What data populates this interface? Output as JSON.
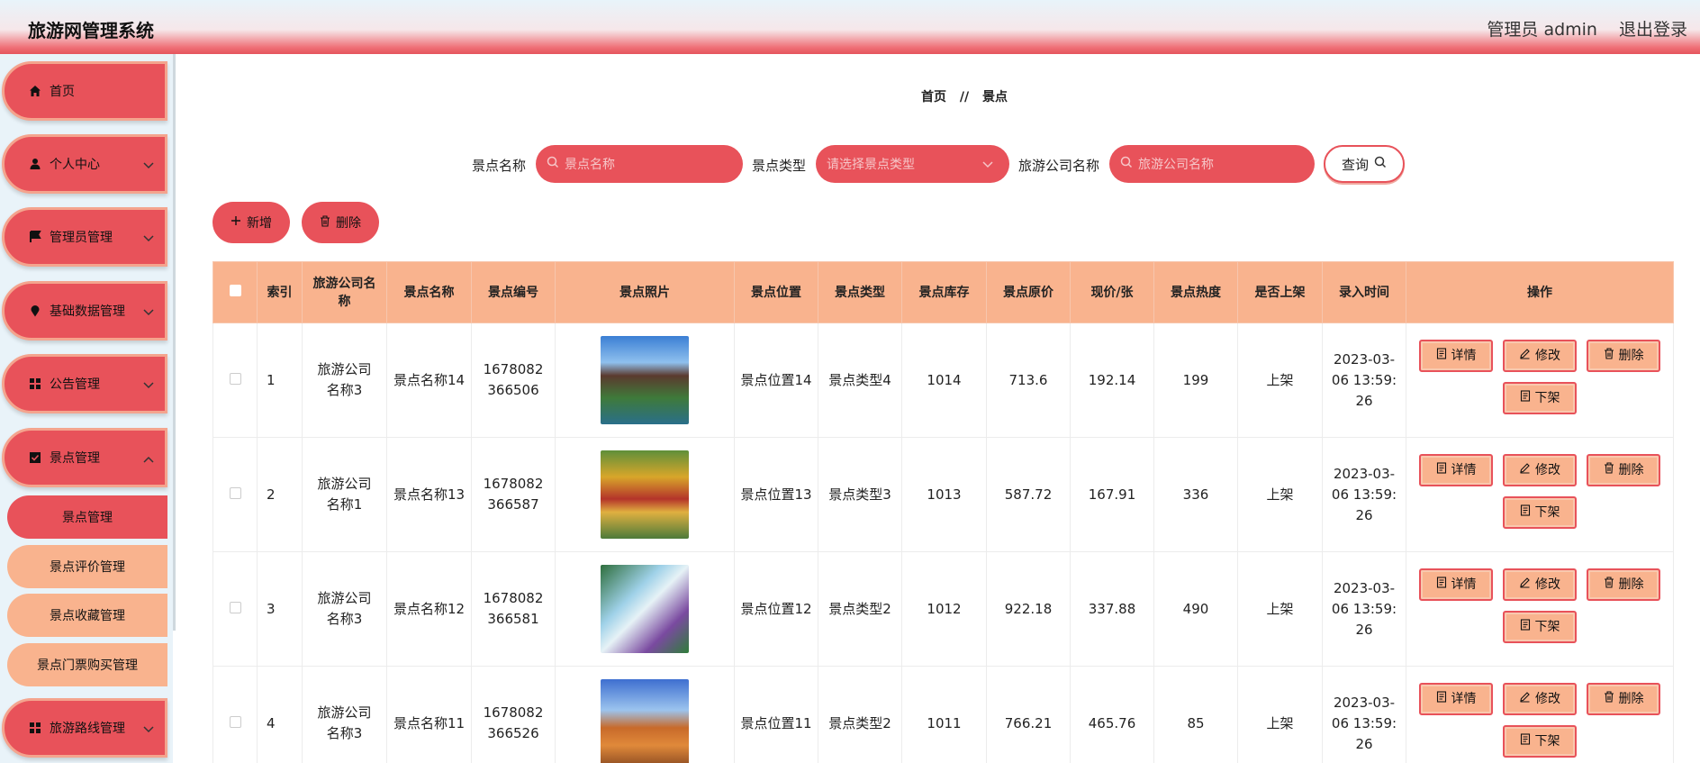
{
  "header": {
    "title": "旅游网管理系统",
    "user": "管理员 admin",
    "logout": "退出登录"
  },
  "sidebar": {
    "items": [
      {
        "label": "首页",
        "icon": "home-icon"
      },
      {
        "label": "个人中心",
        "icon": "user-icon"
      },
      {
        "label": "管理员管理",
        "icon": "flag-icon"
      },
      {
        "label": "基础数据管理",
        "icon": "pin-icon"
      },
      {
        "label": "公告管理",
        "icon": "grid-icon"
      },
      {
        "label": "景点管理",
        "icon": "check-square-icon"
      },
      {
        "label": "旅游路线管理",
        "icon": "grid-icon"
      }
    ],
    "sub_items": [
      "景点管理",
      "景点评价管理",
      "景点收藏管理",
      "景点门票购买管理"
    ]
  },
  "breadcrumb": {
    "home": "首页",
    "separator": "//",
    "current": "景点"
  },
  "search": {
    "name_label": "景点名称",
    "name_placeholder": "景点名称",
    "type_label": "景点类型",
    "type_placeholder": "请选择景点类型",
    "company_label": "旅游公司名称",
    "company_placeholder": "旅游公司名称",
    "query": "查询"
  },
  "actions": {
    "add": "新增",
    "delete": "删除"
  },
  "table": {
    "headers": [
      "索引",
      "旅游公司名称",
      "景点名称",
      "景点编号",
      "景点照片",
      "景点位置",
      "景点类型",
      "景点库存",
      "景点原价",
      "现价/张",
      "景点热度",
      "是否上架",
      "录入时间",
      "操作"
    ],
    "rows": [
      {
        "index": "1",
        "company": "旅游公司名称3",
        "name": "景点名称14",
        "code": "1678082366506",
        "location": "景点位置14",
        "type": "景点类型4",
        "stock": "1014",
        "orig_price": "713.6",
        "price": "192.14",
        "heat": "199",
        "status": "上架",
        "time": "2023-03-06 13:59:26"
      },
      {
        "index": "2",
        "company": "旅游公司名称1",
        "name": "景点名称13",
        "code": "1678082366587",
        "location": "景点位置13",
        "type": "景点类型3",
        "stock": "1013",
        "orig_price": "587.72",
        "price": "167.91",
        "heat": "336",
        "status": "上架",
        "time": "2023-03-06 13:59:26"
      },
      {
        "index": "3",
        "company": "旅游公司名称3",
        "name": "景点名称12",
        "code": "1678082366581",
        "location": "景点位置12",
        "type": "景点类型2",
        "stock": "1012",
        "orig_price": "922.18",
        "price": "337.88",
        "heat": "490",
        "status": "上架",
        "time": "2023-03-06 13:59:26"
      },
      {
        "index": "4",
        "company": "旅游公司名称3",
        "name": "景点名称11",
        "code": "1678082366526",
        "location": "景点位置11",
        "type": "景点类型2",
        "stock": "1011",
        "orig_price": "766.21",
        "price": "465.76",
        "heat": "85",
        "status": "上架",
        "time": "2023-03-06 13:59:26"
      }
    ],
    "row_actions": {
      "detail": "详情",
      "edit": "修改",
      "delete": "删除",
      "offshelf": "下架"
    }
  },
  "colors": {
    "primary": "#e8525a",
    "accent": "#f9b38e",
    "sidebar_bg": "#e9f3f9"
  }
}
